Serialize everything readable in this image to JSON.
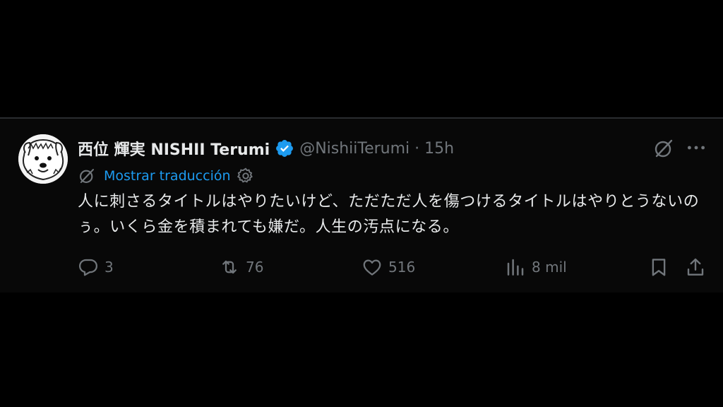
{
  "tweet": {
    "display_name": "西位 輝実 NISHII Terumi",
    "handle": "@NishiiTerumi",
    "separator": "·",
    "time": "15h",
    "translate_label": "Mostrar traducción",
    "text": "人に刺さるタイトルはやりたいけど、ただただ人を傷つけるタイトルはやりとうないのぅ。いくら金を積まれても嫌だ。人生の汚点になる。",
    "replies": "3",
    "reposts": "76",
    "likes": "516",
    "views": "8 mil"
  },
  "icons": {
    "verified": "verified-badge-icon",
    "grok": "grok-icon",
    "more": "more-icon",
    "gear": "gear-icon",
    "reply": "reply-icon",
    "repost": "repost-icon",
    "like": "heart-icon",
    "views": "views-icon",
    "bookmark": "bookmark-icon",
    "share": "share-icon"
  },
  "colors": {
    "background": "#000000",
    "text": "#e7e9ea",
    "secondary": "#71767b",
    "accent": "#1d9bf0"
  }
}
